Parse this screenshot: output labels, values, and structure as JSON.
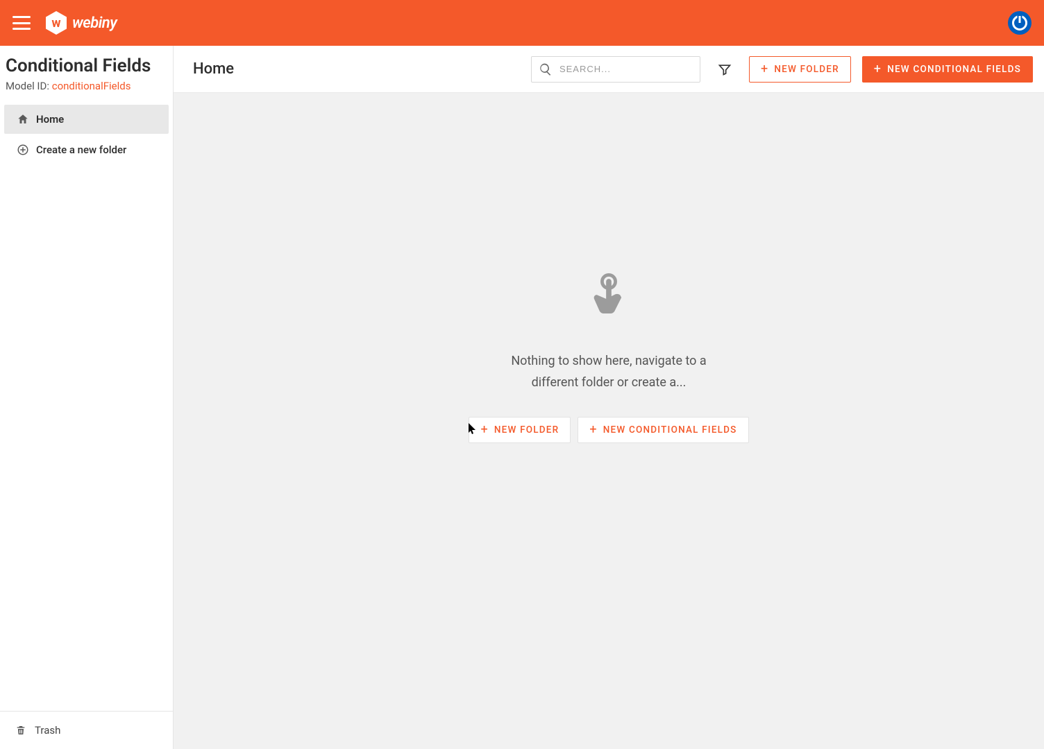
{
  "brand": {
    "name": "webiny",
    "badge_letter": "w"
  },
  "sidebar": {
    "title": "Conditional Fields",
    "model_label": "Model ID: ",
    "model_id": "conditionalFields",
    "items": [
      {
        "label": "Home"
      },
      {
        "label": "Create a new folder"
      }
    ],
    "trash_label": "Trash"
  },
  "toolbar": {
    "breadcrumb": "Home",
    "search_placeholder": "SEARCH...",
    "new_folder_label": "NEW FOLDER",
    "new_entry_label": "NEW CONDITIONAL FIELDS"
  },
  "empty": {
    "message": "Nothing to show here, navigate to a different folder or create a...",
    "new_folder_label": "NEW FOLDER",
    "new_entry_label": "NEW CONDITIONAL FIELDS"
  }
}
